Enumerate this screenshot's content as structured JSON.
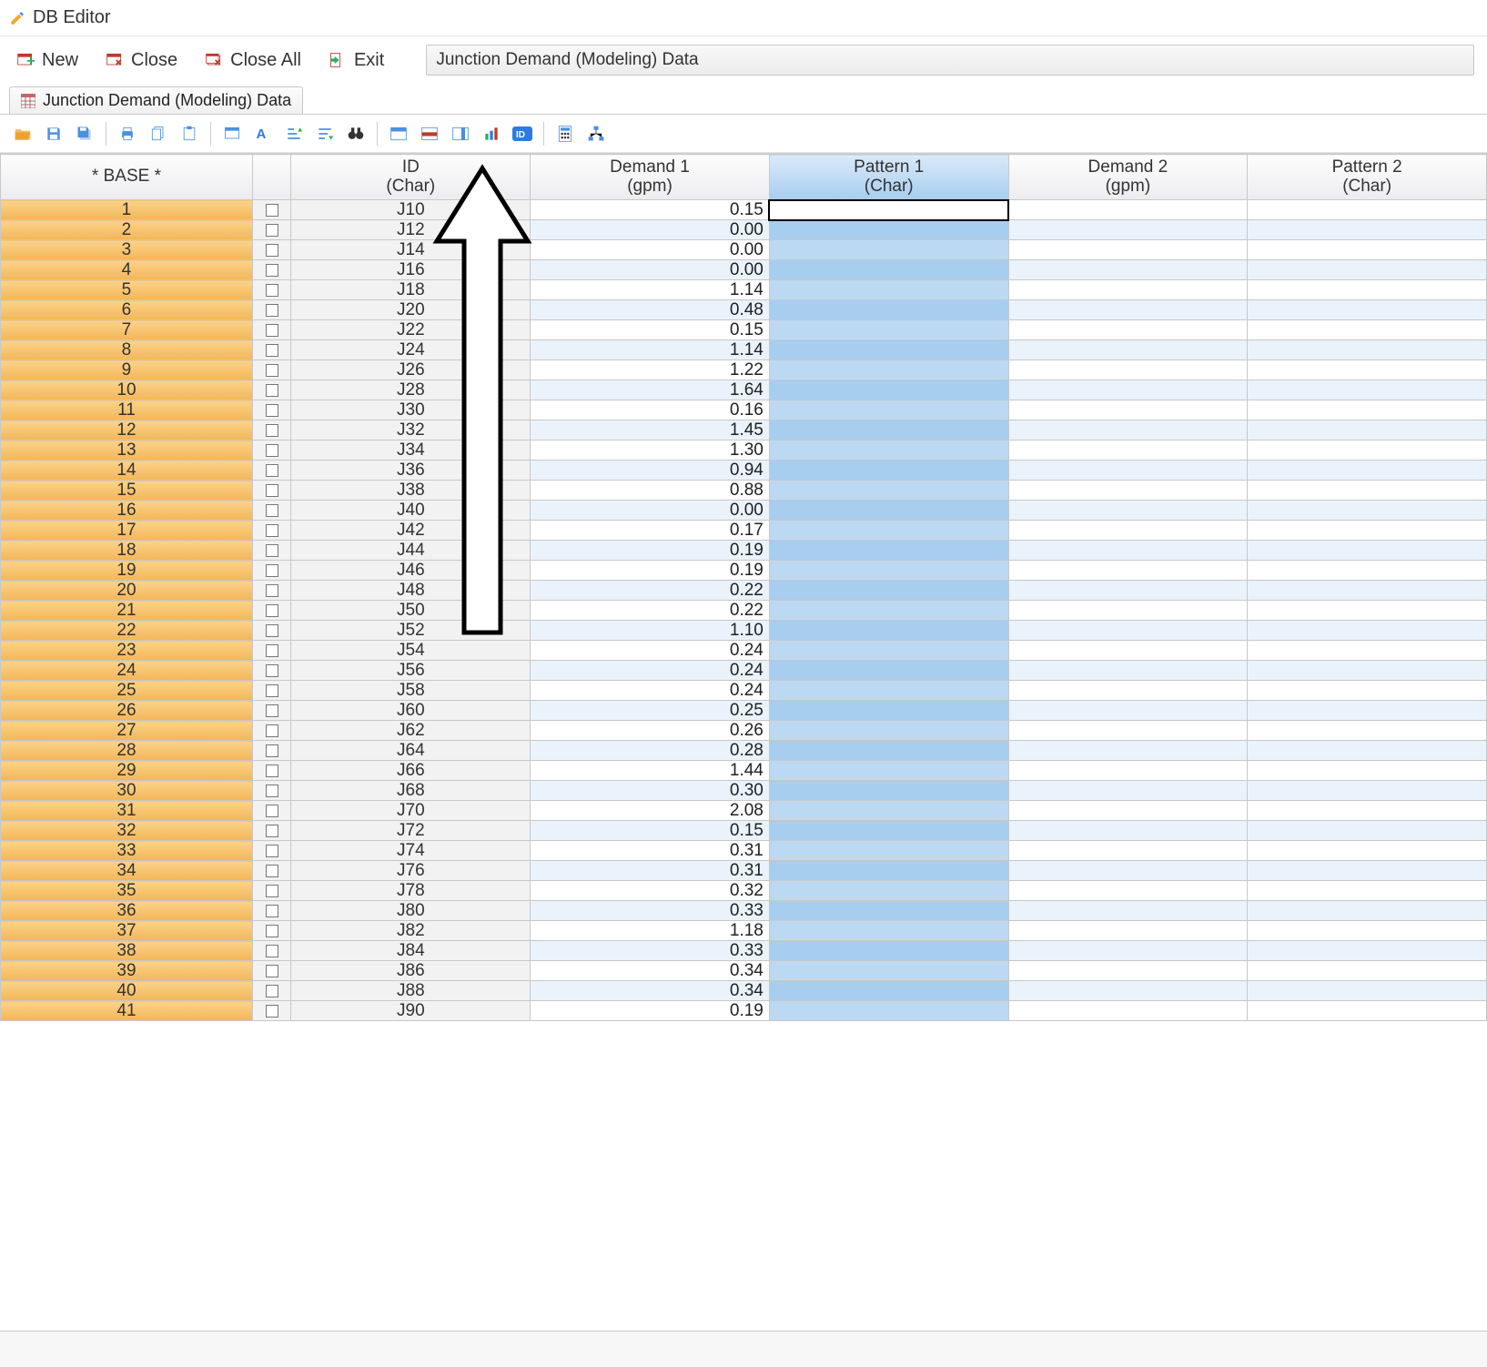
{
  "window": {
    "title": "DB Editor"
  },
  "menu": {
    "new": "New",
    "close": "Close",
    "close_all": "Close All",
    "exit": "Exit",
    "context_value": "Junction Demand (Modeling) Data"
  },
  "tab": {
    "label": "Junction Demand (Modeling) Data"
  },
  "grid": {
    "base_label": "* BASE *",
    "columns": [
      {
        "line1": "ID",
        "line2": "(Char)"
      },
      {
        "line1": "Demand 1",
        "line2": "(gpm)"
      },
      {
        "line1": "Pattern 1",
        "line2": "(Char)"
      },
      {
        "line1": "Demand 2",
        "line2": "(gpm)"
      },
      {
        "line1": "Pattern 2",
        "line2": "(Char)"
      }
    ],
    "rows": [
      {
        "n": 1,
        "id": "J10",
        "d1": "0.15",
        "p1": "",
        "d2": "",
        "p2": "",
        "editing": true
      },
      {
        "n": 2,
        "id": "J12",
        "d1": "0.00",
        "p1": "",
        "d2": "",
        "p2": ""
      },
      {
        "n": 3,
        "id": "J14",
        "d1": "0.00",
        "p1": "",
        "d2": "",
        "p2": ""
      },
      {
        "n": 4,
        "id": "J16",
        "d1": "0.00",
        "p1": "",
        "d2": "",
        "p2": ""
      },
      {
        "n": 5,
        "id": "J18",
        "d1": "1.14",
        "p1": "",
        "d2": "",
        "p2": ""
      },
      {
        "n": 6,
        "id": "J20",
        "d1": "0.48",
        "p1": "",
        "d2": "",
        "p2": ""
      },
      {
        "n": 7,
        "id": "J22",
        "d1": "0.15",
        "p1": "",
        "d2": "",
        "p2": ""
      },
      {
        "n": 8,
        "id": "J24",
        "d1": "1.14",
        "p1": "",
        "d2": "",
        "p2": ""
      },
      {
        "n": 9,
        "id": "J26",
        "d1": "1.22",
        "p1": "",
        "d2": "",
        "p2": ""
      },
      {
        "n": 10,
        "id": "J28",
        "d1": "1.64",
        "p1": "",
        "d2": "",
        "p2": ""
      },
      {
        "n": 11,
        "id": "J30",
        "d1": "0.16",
        "p1": "",
        "d2": "",
        "p2": ""
      },
      {
        "n": 12,
        "id": "J32",
        "d1": "1.45",
        "p1": "",
        "d2": "",
        "p2": ""
      },
      {
        "n": 13,
        "id": "J34",
        "d1": "1.30",
        "p1": "",
        "d2": "",
        "p2": ""
      },
      {
        "n": 14,
        "id": "J36",
        "d1": "0.94",
        "p1": "",
        "d2": "",
        "p2": ""
      },
      {
        "n": 15,
        "id": "J38",
        "d1": "0.88",
        "p1": "",
        "d2": "",
        "p2": ""
      },
      {
        "n": 16,
        "id": "J40",
        "d1": "0.00",
        "p1": "",
        "d2": "",
        "p2": ""
      },
      {
        "n": 17,
        "id": "J42",
        "d1": "0.17",
        "p1": "",
        "d2": "",
        "p2": ""
      },
      {
        "n": 18,
        "id": "J44",
        "d1": "0.19",
        "p1": "",
        "d2": "",
        "p2": ""
      },
      {
        "n": 19,
        "id": "J46",
        "d1": "0.19",
        "p1": "",
        "d2": "",
        "p2": ""
      },
      {
        "n": 20,
        "id": "J48",
        "d1": "0.22",
        "p1": "",
        "d2": "",
        "p2": ""
      },
      {
        "n": 21,
        "id": "J50",
        "d1": "0.22",
        "p1": "",
        "d2": "",
        "p2": ""
      },
      {
        "n": 22,
        "id": "J52",
        "d1": "1.10",
        "p1": "",
        "d2": "",
        "p2": ""
      },
      {
        "n": 23,
        "id": "J54",
        "d1": "0.24",
        "p1": "",
        "d2": "",
        "p2": ""
      },
      {
        "n": 24,
        "id": "J56",
        "d1": "0.24",
        "p1": "",
        "d2": "",
        "p2": ""
      },
      {
        "n": 25,
        "id": "J58",
        "d1": "0.24",
        "p1": "",
        "d2": "",
        "p2": ""
      },
      {
        "n": 26,
        "id": "J60",
        "d1": "0.25",
        "p1": "",
        "d2": "",
        "p2": ""
      },
      {
        "n": 27,
        "id": "J62",
        "d1": "0.26",
        "p1": "",
        "d2": "",
        "p2": ""
      },
      {
        "n": 28,
        "id": "J64",
        "d1": "0.28",
        "p1": "",
        "d2": "",
        "p2": ""
      },
      {
        "n": 29,
        "id": "J66",
        "d1": "1.44",
        "p1": "",
        "d2": "",
        "p2": ""
      },
      {
        "n": 30,
        "id": "J68",
        "d1": "0.30",
        "p1": "",
        "d2": "",
        "p2": ""
      },
      {
        "n": 31,
        "id": "J70",
        "d1": "2.08",
        "p1": "",
        "d2": "",
        "p2": ""
      },
      {
        "n": 32,
        "id": "J72",
        "d1": "0.15",
        "p1": "",
        "d2": "",
        "p2": ""
      },
      {
        "n": 33,
        "id": "J74",
        "d1": "0.31",
        "p1": "",
        "d2": "",
        "p2": ""
      },
      {
        "n": 34,
        "id": "J76",
        "d1": "0.31",
        "p1": "",
        "d2": "",
        "p2": ""
      },
      {
        "n": 35,
        "id": "J78",
        "d1": "0.32",
        "p1": "",
        "d2": "",
        "p2": ""
      },
      {
        "n": 36,
        "id": "J80",
        "d1": "0.33",
        "p1": "",
        "d2": "",
        "p2": ""
      },
      {
        "n": 37,
        "id": "J82",
        "d1": "1.18",
        "p1": "",
        "d2": "",
        "p2": ""
      },
      {
        "n": 38,
        "id": "J84",
        "d1": "0.33",
        "p1": "",
        "d2": "",
        "p2": ""
      },
      {
        "n": 39,
        "id": "J86",
        "d1": "0.34",
        "p1": "",
        "d2": "",
        "p2": ""
      },
      {
        "n": 40,
        "id": "J88",
        "d1": "0.34",
        "p1": "",
        "d2": "",
        "p2": ""
      },
      {
        "n": 41,
        "id": "J90",
        "d1": "0.19",
        "p1": "",
        "d2": "",
        "p2": ""
      }
    ]
  }
}
